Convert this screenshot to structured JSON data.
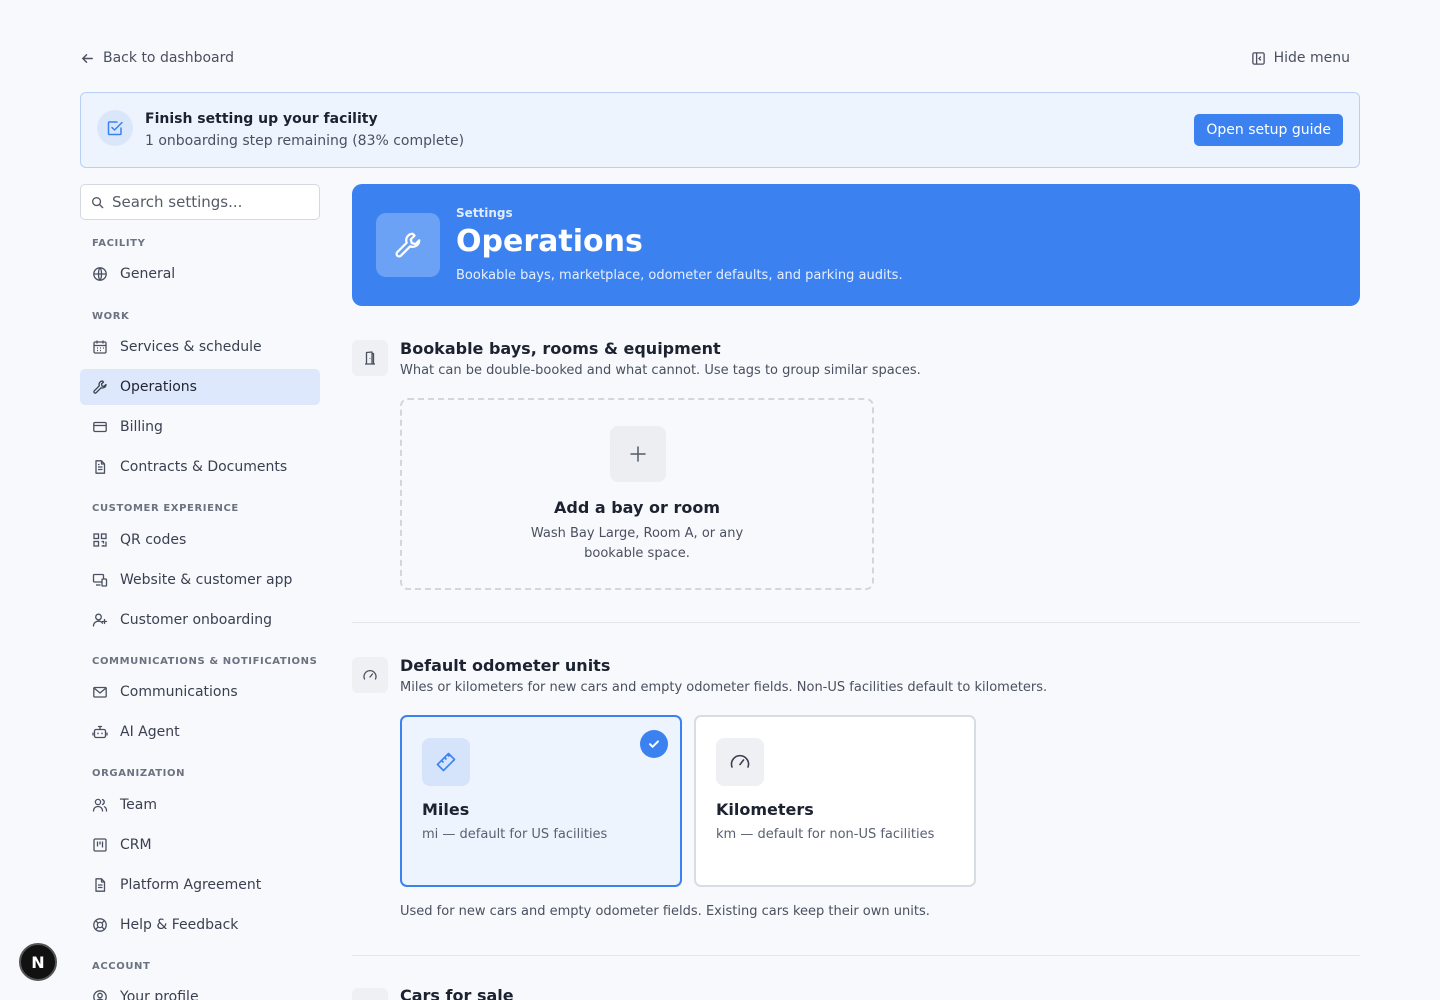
{
  "topbar": {
    "back_label": "Back to dashboard",
    "hide_label": "Hide menu"
  },
  "banner": {
    "title": "Finish setting up your facility",
    "subtitle": "1 onboarding step remaining (83% complete)",
    "button_label": "Open setup guide",
    "progress_percent": 83
  },
  "sidebar": {
    "search_placeholder": "Search settings...",
    "sections": {
      "facility": "FACILITY",
      "work": "WORK",
      "customer_experience": "CUSTOMER EXPERIENCE",
      "communications": "COMMUNICATIONS & NOTIFICATIONS",
      "organization": "ORGANIZATION",
      "account": "ACCOUNT"
    },
    "items": {
      "general": "General",
      "services": "Services & schedule",
      "operations": "Operations",
      "billing": "Billing",
      "contracts": "Contracts & Documents",
      "qr": "QR codes",
      "website": "Website & customer app",
      "onboarding": "Customer onboarding",
      "communications": "Communications",
      "ai_agent": "AI Agent",
      "team": "Team",
      "crm": "CRM",
      "platform": "Platform Agreement",
      "help": "Help & Feedback",
      "profile": "Your profile"
    },
    "active_item": "Operations"
  },
  "hero": {
    "eyebrow": "Settings",
    "title": "Operations",
    "subtitle": "Bookable bays, marketplace, odometer defaults, and parking audits."
  },
  "bays": {
    "title": "Bookable bays, rooms & equipment",
    "subtitle": "What can be double-booked and what cannot. Use tags to group similar spaces.",
    "add_title": "Add a bay or room",
    "add_subtitle": "Wash Bay Large, Room A, or any bookable space."
  },
  "odometer": {
    "title": "Default odometer units",
    "subtitle": "Miles or kilometers for new cars and empty odometer fields. Non-US facilities default to kilometers.",
    "miles": {
      "title": "Miles",
      "subtitle": "mi — default for US facilities",
      "selected": true
    },
    "km": {
      "title": "Kilometers",
      "subtitle": "km — default for non-US facilities",
      "selected": false
    },
    "note": "Used for new cars and empty odometer fields. Existing cars keep their own units."
  },
  "cars": {
    "title": "Cars for sale"
  },
  "fab": {
    "label": "N"
  },
  "colors": {
    "accent": "#3b82f0",
    "active_bg": "#dde8fc",
    "banner_bg": "#eef4fe",
    "page_bg": "#f7f9fc"
  }
}
